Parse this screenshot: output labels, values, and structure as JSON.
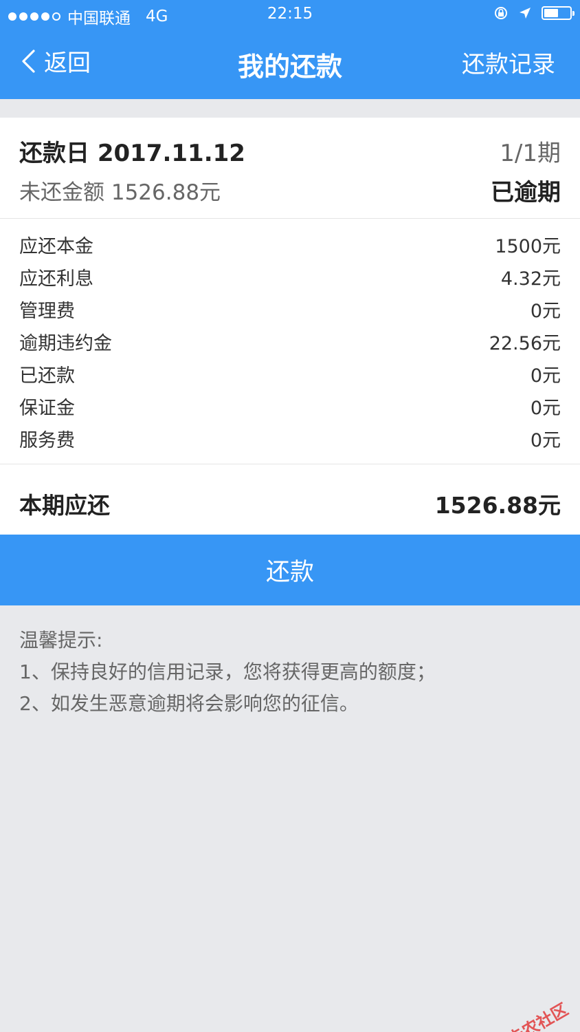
{
  "status_bar": {
    "carrier": "中国联通",
    "network": "4G",
    "time": "22:15",
    "battery_level": 0.55
  },
  "nav": {
    "back_label": "返回",
    "title": "我的还款",
    "record_label": "还款记录"
  },
  "summary": {
    "due_date": "还款日 2017.11.12",
    "period": "1/1期",
    "unpaid": "未还金额 1526.88元",
    "status": "已逾期"
  },
  "details": [
    {
      "label": "应还本金",
      "value": "1500元"
    },
    {
      "label": "应还利息",
      "value": "4.32元"
    },
    {
      "label": "管理费",
      "value": "0元"
    },
    {
      "label": "逾期违约金",
      "value": "22.56元"
    },
    {
      "label": "已还款",
      "value": "0元"
    },
    {
      "label": "保证金",
      "value": "0元"
    },
    {
      "label": "服务费",
      "value": "0元"
    }
  ],
  "total": {
    "label": "本期应还",
    "value": "1526.88元"
  },
  "pay_button": "还款",
  "tips": {
    "title": "温馨提示:",
    "line1": "1、保持良好的信用记录，您将获得更高的额度；",
    "line2": "2、如发生恶意逾期将会影响您的征信。"
  },
  "watermark": "卡农社区",
  "colors": {
    "primary": "#3796f5",
    "background": "#e8e9ec",
    "watermark": "#e23b3b"
  }
}
